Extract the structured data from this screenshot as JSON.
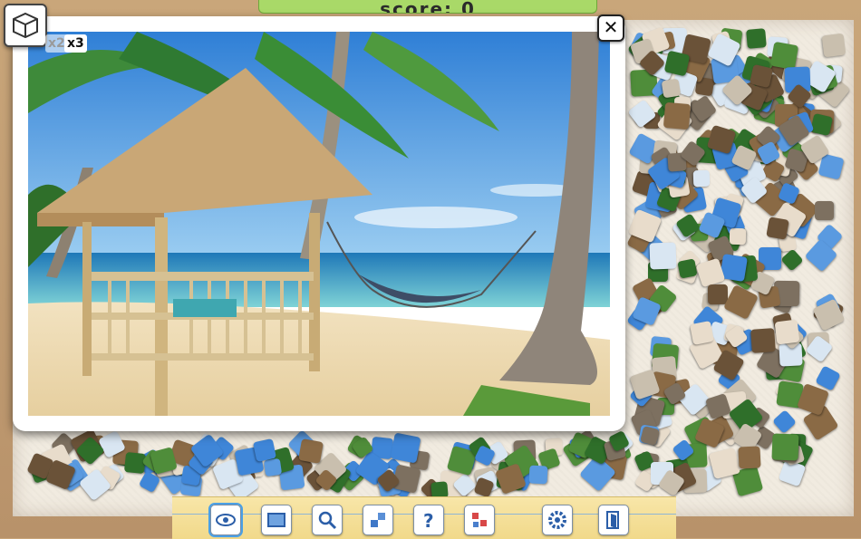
{
  "score": {
    "label": "score: 0"
  },
  "multipliers": {
    "x2": "x2",
    "x3": "x3"
  },
  "preview": {
    "close_label": "✕"
  },
  "toolbar": {
    "buttons": [
      "preview-toggle",
      "show-edges",
      "magnifier",
      "sort-pieces",
      "help",
      "scatter",
      "settings",
      "exit"
    ]
  },
  "colors": {
    "banner": "#a9d968",
    "board": "#f1ebe0",
    "toolbar": "#f4dd93",
    "accent": "#4aa0e6"
  }
}
